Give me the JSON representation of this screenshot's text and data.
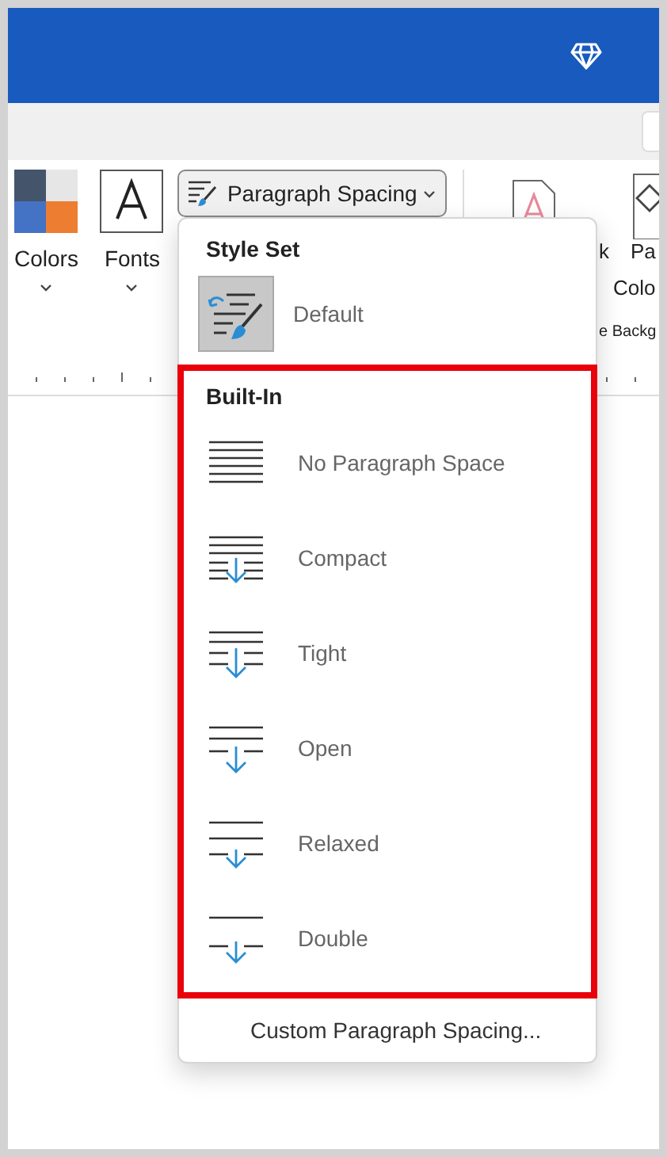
{
  "ribbon": {
    "groups": [
      {
        "label": "Colors",
        "kind": "colors"
      },
      {
        "label": "Fonts",
        "kind": "fonts"
      }
    ],
    "paragraph_spacing_button": "Paragraph Spacing",
    "partial_labels": [
      "k",
      "Pa",
      "Colo",
      "e Backg"
    ]
  },
  "menu": {
    "style_set_header": "Style Set",
    "style_set_items": [
      {
        "label": "Default",
        "selected": true
      }
    ],
    "builtin_header": "Built-In",
    "builtin_items": [
      {
        "label": "No Paragraph Space",
        "kind": "none"
      },
      {
        "label": "Compact",
        "kind": "compact"
      },
      {
        "label": "Tight",
        "kind": "tight"
      },
      {
        "label": "Open",
        "kind": "open"
      },
      {
        "label": "Relaxed",
        "kind": "relaxed"
      },
      {
        "label": "Double",
        "kind": "double"
      }
    ],
    "footer": "Custom Paragraph Spacing..."
  }
}
